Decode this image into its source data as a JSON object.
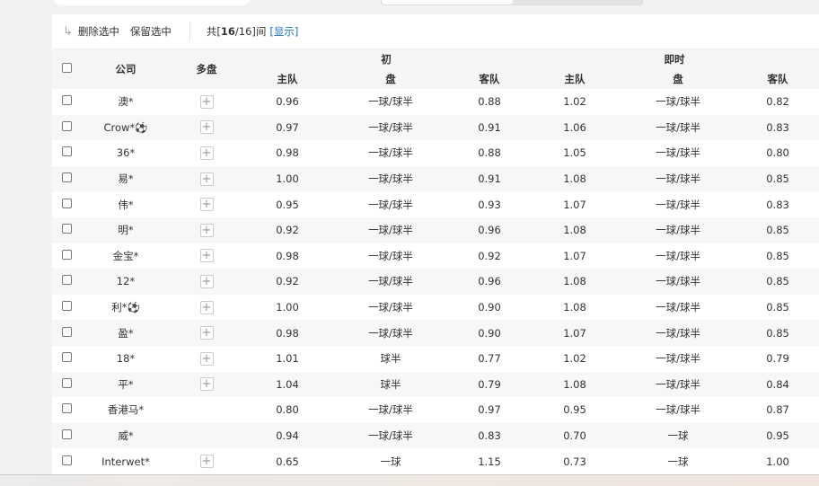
{
  "toolbar": {
    "delete_selected": "删除选中",
    "keep_selected": "保留选中",
    "count_prefix": "共[",
    "count_shown": "16",
    "count_total": "/16]间",
    "show_link": "[显示]"
  },
  "headers": {
    "company": "公司",
    "multi": "多盘",
    "initial": "初",
    "live": "即时",
    "home": "主队",
    "line": "盘",
    "away": "客队"
  },
  "rows": [
    {
      "company": "澳*",
      "multi": true,
      "i_home": "0.96",
      "i_line": "一球/球半",
      "i_away": "0.88",
      "l_home": "1.02",
      "l_line": "一球/球半",
      "l_away": "0.82"
    },
    {
      "company": "Crow*⚽",
      "multi": true,
      "i_home": "0.97",
      "i_line": "一球/球半",
      "i_away": "0.91",
      "l_home": "1.06",
      "l_line": "一球/球半",
      "l_away": "0.83"
    },
    {
      "company": "36*",
      "multi": true,
      "i_home": "0.98",
      "i_line": "一球/球半",
      "i_away": "0.88",
      "l_home": "1.05",
      "l_line": "一球/球半",
      "l_away": "0.80"
    },
    {
      "company": "易*",
      "multi": true,
      "i_home": "1.00",
      "i_line": "一球/球半",
      "i_away": "0.91",
      "l_home": "1.08",
      "l_line": "一球/球半",
      "l_away": "0.85"
    },
    {
      "company": "伟*",
      "multi": true,
      "i_home": "0.95",
      "i_line": "一球/球半",
      "i_away": "0.93",
      "l_home": "1.07",
      "l_line": "一球/球半",
      "l_away": "0.83"
    },
    {
      "company": "明*",
      "multi": true,
      "i_home": "0.92",
      "i_line": "一球/球半",
      "i_away": "0.96",
      "l_home": "1.08",
      "l_line": "一球/球半",
      "l_away": "0.85"
    },
    {
      "company": "金宝*",
      "multi": true,
      "i_home": "0.98",
      "i_line": "一球/球半",
      "i_away": "0.92",
      "l_home": "1.07",
      "l_line": "一球/球半",
      "l_away": "0.85"
    },
    {
      "company": "12*",
      "multi": true,
      "i_home": "0.92",
      "i_line": "一球/球半",
      "i_away": "0.96",
      "l_home": "1.08",
      "l_line": "一球/球半",
      "l_away": "0.85"
    },
    {
      "company": "利*⚽",
      "multi": true,
      "i_home": "1.00",
      "i_line": "一球/球半",
      "i_away": "0.90",
      "l_home": "1.08",
      "l_line": "一球/球半",
      "l_away": "0.85"
    },
    {
      "company": "盈*",
      "multi": true,
      "i_home": "0.98",
      "i_line": "一球/球半",
      "i_away": "0.90",
      "l_home": "1.07",
      "l_line": "一球/球半",
      "l_away": "0.85"
    },
    {
      "company": "18*",
      "multi": true,
      "i_home": "1.01",
      "i_line": "球半",
      "i_away": "0.77",
      "l_home": "1.02",
      "l_line": "一球/球半",
      "l_away": "0.79"
    },
    {
      "company": "平*",
      "multi": true,
      "i_home": "1.04",
      "i_line": "球半",
      "i_away": "0.79",
      "l_home": "1.08",
      "l_line": "一球/球半",
      "l_away": "0.84"
    },
    {
      "company": "香港马*",
      "multi": false,
      "i_home": "0.80",
      "i_line": "一球/球半",
      "i_away": "0.97",
      "l_home": "0.95",
      "l_line": "一球/球半",
      "l_away": "0.87"
    },
    {
      "company": "威*",
      "multi": false,
      "i_home": "0.94",
      "i_line": "一球/球半",
      "i_away": "0.83",
      "l_home": "0.70",
      "l_line": "一球",
      "l_away": "0.95"
    },
    {
      "company": "Interwet*",
      "multi": true,
      "i_home": "0.65",
      "i_line": "一球",
      "i_away": "1.15",
      "l_home": "0.73",
      "l_line": "一球",
      "l_away": "1.00"
    }
  ]
}
